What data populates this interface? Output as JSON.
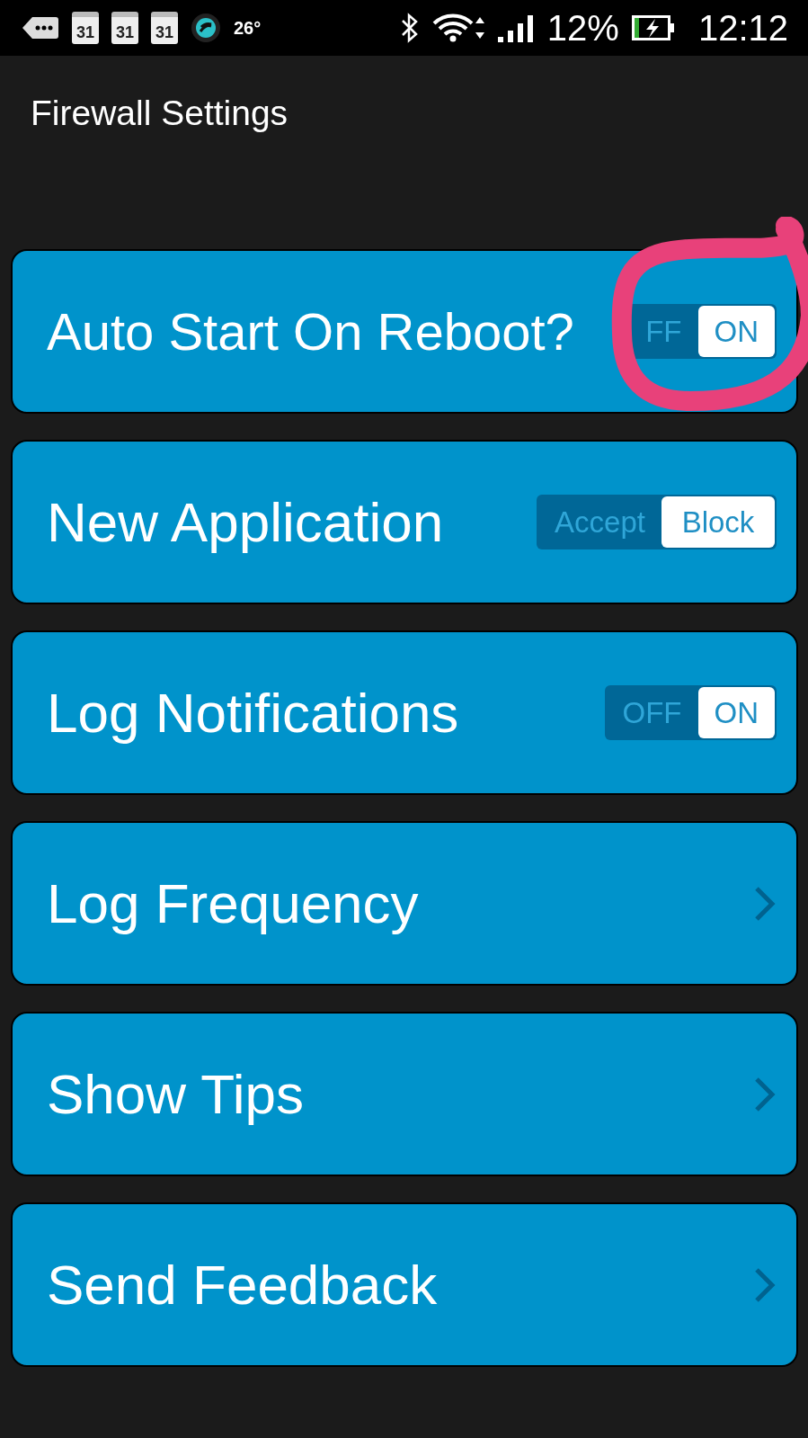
{
  "status_bar": {
    "calendar_dates": [
      "31",
      "31",
      "31"
    ],
    "temperature": "26°",
    "battery": "12%",
    "time": "12:12"
  },
  "title": "Firewall Settings",
  "settings": [
    {
      "kind": "toggle",
      "label": "Auto Start On Reboot?",
      "options": [
        {
          "label": "FF",
          "selected": false
        },
        {
          "label": "ON",
          "selected": true
        }
      ]
    },
    {
      "kind": "toggle",
      "label": "New Application",
      "options": [
        {
          "label": "Accept",
          "selected": false
        },
        {
          "label": "Block",
          "selected": true
        }
      ]
    },
    {
      "kind": "toggle",
      "label": "Log Notifications",
      "options": [
        {
          "label": "OFF",
          "selected": false
        },
        {
          "label": "ON",
          "selected": true
        }
      ]
    },
    {
      "kind": "link",
      "label": "Log Frequency"
    },
    {
      "kind": "link",
      "label": "Show Tips"
    },
    {
      "kind": "link",
      "label": "Send Feedback"
    }
  ]
}
